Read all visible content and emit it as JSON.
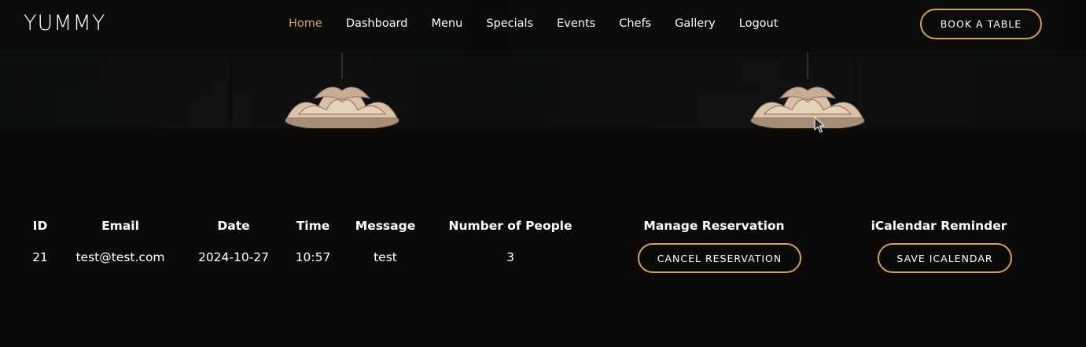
{
  "header": {
    "logo": "YUMMY",
    "nav": [
      {
        "label": "Home",
        "active": true
      },
      {
        "label": "Dashboard",
        "active": false
      },
      {
        "label": "Menu",
        "active": false
      },
      {
        "label": "Specials",
        "active": false
      },
      {
        "label": "Events",
        "active": false
      },
      {
        "label": "Chefs",
        "active": false
      },
      {
        "label": "Gallery",
        "active": false
      },
      {
        "label": "Logout",
        "active": false
      }
    ],
    "book_button": "BOOK A TABLE"
  },
  "reservations": {
    "columns": [
      "ID",
      "Email",
      "Date",
      "Time",
      "Message",
      "Number of People",
      "Manage Reservation",
      "iCalendar Reminder"
    ],
    "rows": [
      {
        "id": "21",
        "email": "test@test.com",
        "date": "2024-10-27",
        "time": "10:57",
        "message": "test",
        "people": "3",
        "cancel_label": "CANCEL RESERVATION",
        "ical_label": "SAVE ICALENDAR"
      }
    ]
  },
  "colors": {
    "accent": "#cda45e",
    "background": "#0c0a09",
    "text": "#ffffff"
  },
  "icons": {
    "cursor": "mouse-pointer-icon"
  }
}
